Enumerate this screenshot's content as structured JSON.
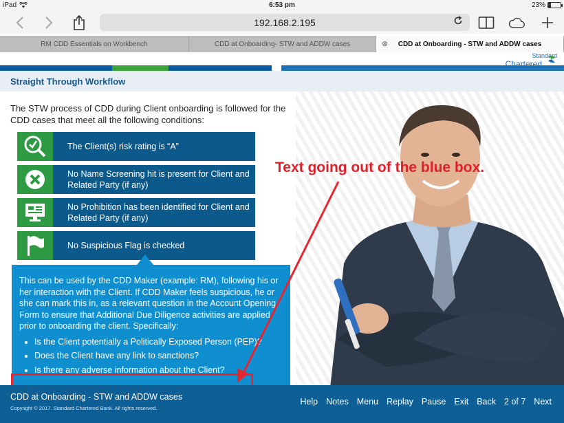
{
  "status": {
    "device": "iPad",
    "time": "6:53 pm",
    "battery": "23%",
    "battery_level": 0.23
  },
  "browser": {
    "url": "192.168.2.195",
    "tabs": [
      {
        "label": "RM CDD Essentials on Workbench"
      },
      {
        "label": "CDD at Onboarding- STW and ADDW cases"
      },
      {
        "label": "CDD at Onboarding - STW and ADDW cases"
      }
    ]
  },
  "brand": {
    "line1": "Standard",
    "line2": "Chartered"
  },
  "page": {
    "title": "Straight Through Workflow",
    "intro": "The STW process of CDD during Client onboarding is followed for the CDD cases that meet all the following conditions:",
    "conditions": [
      {
        "text": "The Client(s) risk rating is “A”",
        "icon": "magnifier-check-icon"
      },
      {
        "text": "No Name Screening hit is present for Client and Related Party (if any)",
        "icon": "x-circle-icon"
      },
      {
        "text": "No Prohibition has been identified for Client and Related Party (if any)",
        "icon": "monitor-icon"
      },
      {
        "text": "No Suspicious Flag is checked",
        "icon": "flag-icon"
      }
    ],
    "callout": {
      "text": "This can be used by the CDD Maker (example: RM), following his or her interaction with the Client. If CDD Maker feels suspicious, he or she can mark this in, as a relevant question in the Account Opening Form to ensure that Additional Due Diligence activities are applied prior to onboarding the client. Specifically:",
      "bullets": [
        "Is the Client potentially a Politically Exposed Person (PEP)?",
        "Does the Client have any link to sanctions?",
        "Is there any adverse information about the Client?"
      ]
    },
    "annotation": "Text going out of the blue box."
  },
  "footer": {
    "title": "CDD at Onboarding - STW and ADDW cases",
    "copyright": "Copyright © 2017. Standard Chartered Bank. All rights reserved.",
    "nav": {
      "help": "Help",
      "notes": "Notes",
      "menu": "Menu",
      "replay": "Replay",
      "pause": "Pause",
      "exit": "Exit",
      "back": "Back",
      "page": "2 of 7",
      "next": "Next"
    }
  }
}
